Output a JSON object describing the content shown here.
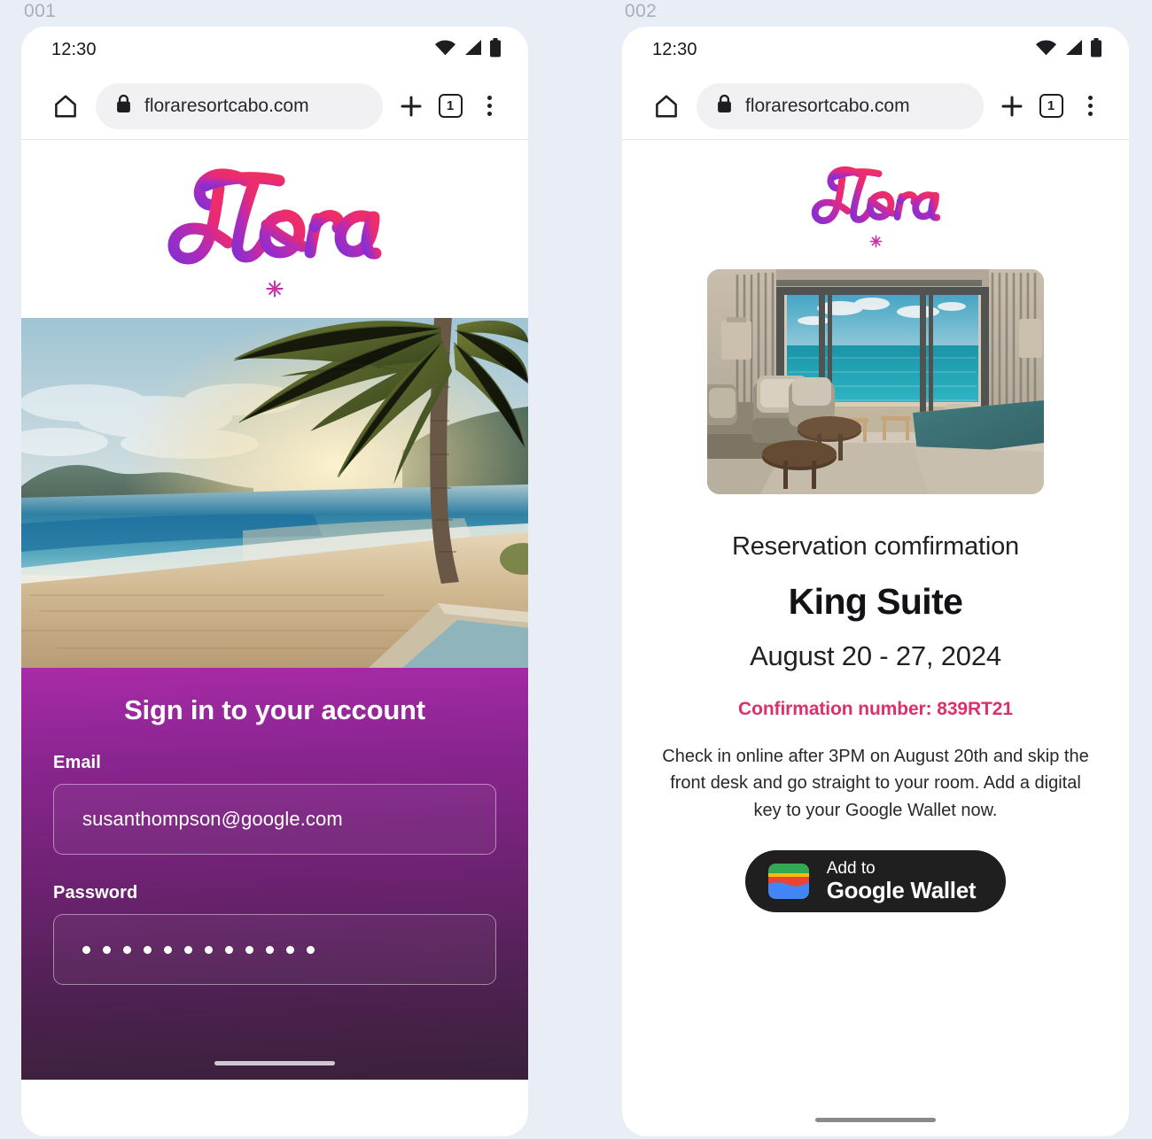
{
  "page": {
    "background": "#e9edf5"
  },
  "brand": {
    "name": "Flora",
    "accent_pink": "#e8276e",
    "accent_purple": "#9b2fc0",
    "logo_icon": "flora-script-logo",
    "flower_icon": "asterisk-flower-icon"
  },
  "screens": [
    {
      "label": "001",
      "statusbar": {
        "time": "12:30",
        "icons": [
          "wifi-icon",
          "cellular-signal-icon",
          "battery-icon"
        ]
      },
      "browser": {
        "home_icon": "home-icon",
        "lock_icon": "lock-icon",
        "url": "floraresortcabo.com",
        "new_tab_icon": "plus-icon",
        "tab_count": "1",
        "menu_icon": "kebab-menu-icon"
      },
      "hero": {
        "alt": "tropical-beach-palm-tree-sunset-photo"
      },
      "signin": {
        "heading": "Sign in to your account",
        "gradient_top": "#a92ba8",
        "gradient_bottom": "#3a213b",
        "email": {
          "label": "Email",
          "value": "susanthompson@google.com",
          "placeholder": "Email"
        },
        "password": {
          "label": "Password",
          "masked": "••••••••••••",
          "dot_count": 12,
          "placeholder": "Password"
        }
      }
    },
    {
      "label": "002",
      "statusbar": {
        "time": "12:30",
        "icons": [
          "wifi-icon",
          "cellular-signal-icon",
          "battery-icon"
        ]
      },
      "browser": {
        "home_icon": "home-icon",
        "lock_icon": "lock-icon",
        "url": "floraresortcabo.com",
        "new_tab_icon": "plus-icon",
        "tab_count": "1",
        "menu_icon": "kebab-menu-icon"
      },
      "room_photo": {
        "alt": "hotel-suite-ocean-view-photo"
      },
      "confirmation": {
        "subtitle": "Reservation comfirmation",
        "room": "King Suite",
        "dates": "August 20 - 27, 2024",
        "number": "Confirmation number: 839RT21",
        "number_color": "#dd2f6c",
        "body": "Check in online after 3PM on August 20th and skip the front desk and go straight to your room. Add a digital key to your Google Wallet now.",
        "wallet_button": {
          "line1": "Add to",
          "line2": "Google Wallet",
          "icon": "google-wallet-icon",
          "background": "#1f1f1f"
        }
      }
    }
  ]
}
